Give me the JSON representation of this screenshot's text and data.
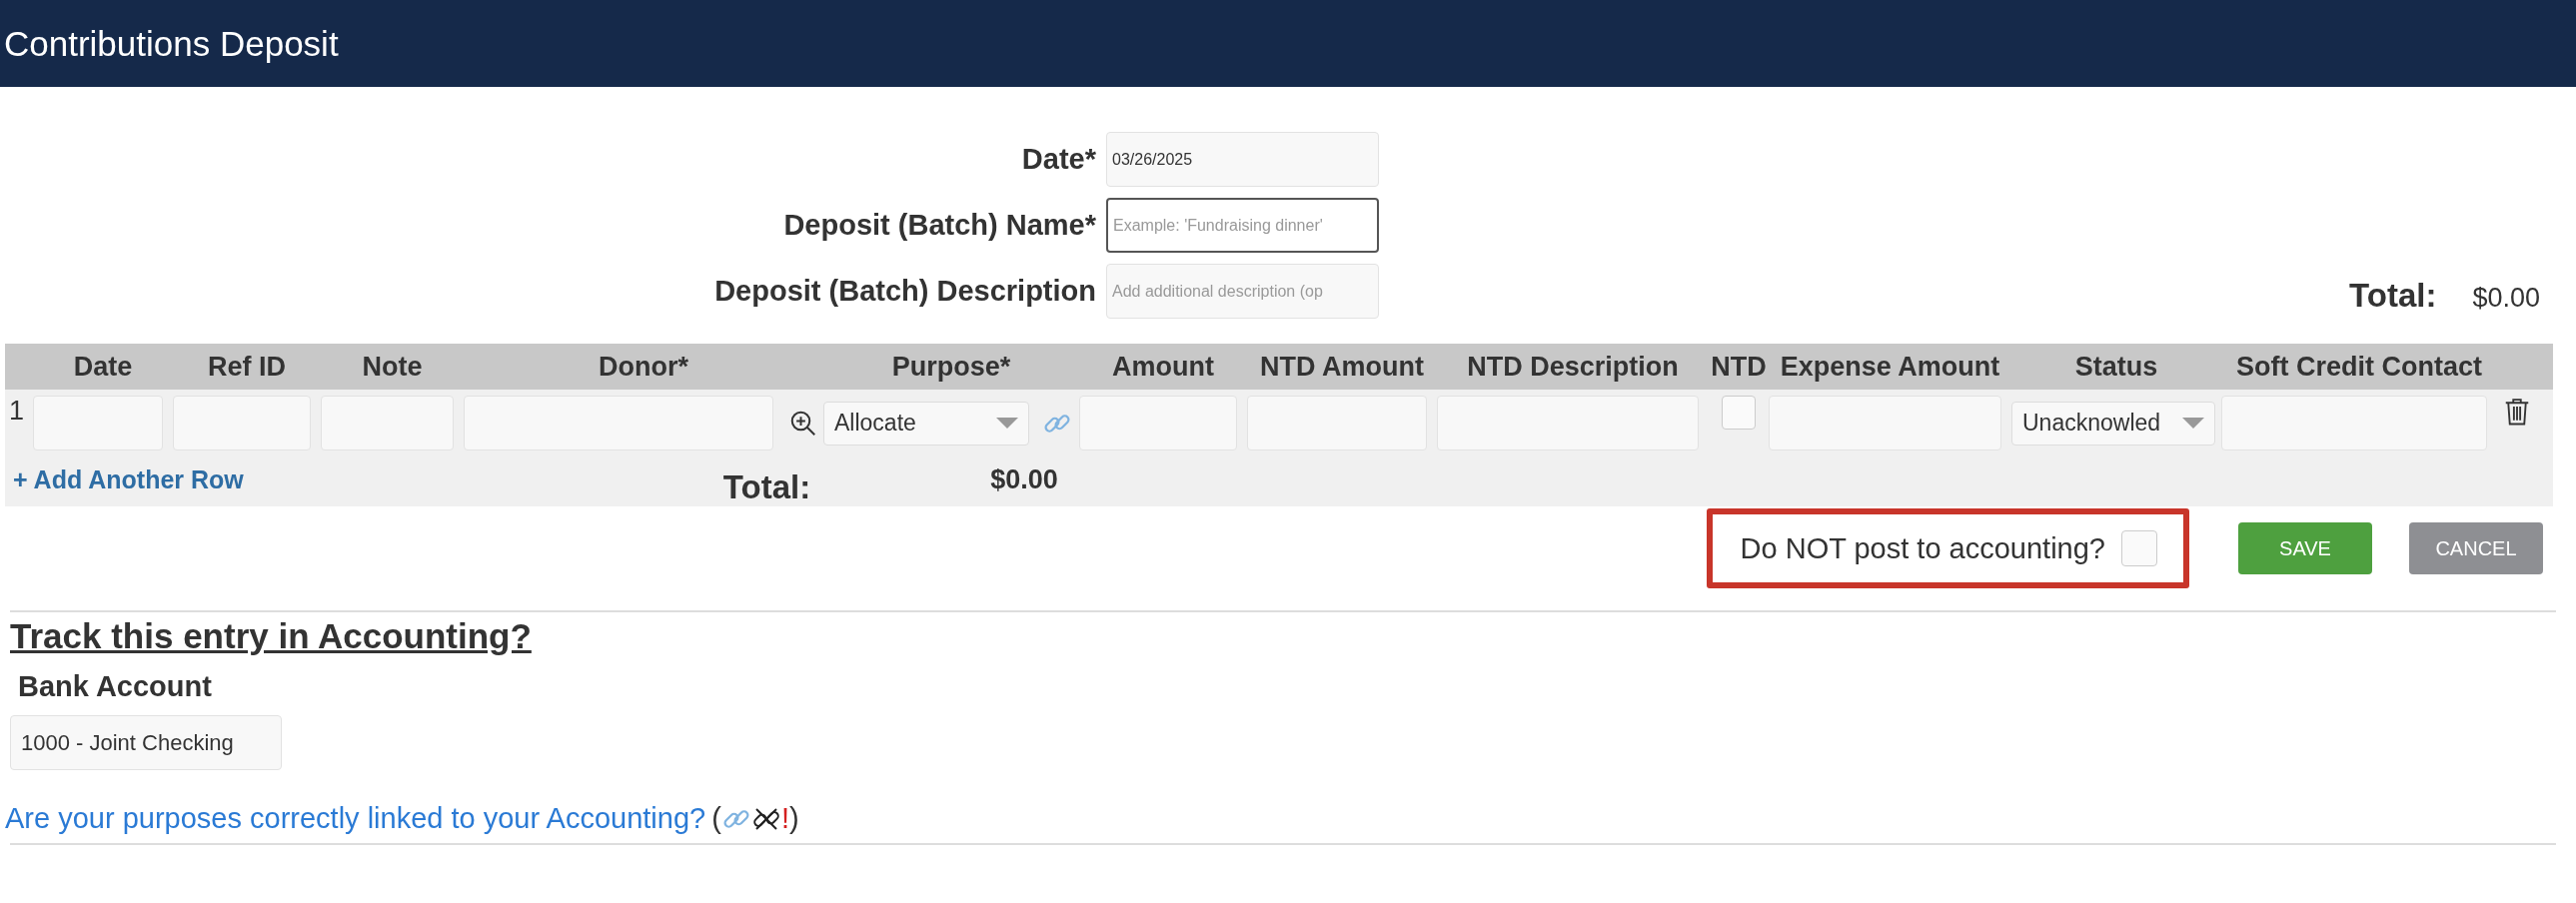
{
  "header": {
    "title": "Contributions Deposit"
  },
  "form": {
    "fields": [
      {
        "label": "Date*",
        "value": "03/26/2025",
        "focused": false
      },
      {
        "label": "Deposit (Batch) Name*",
        "placeholder": "Example: 'Fundraising dinner'",
        "focused": true
      },
      {
        "label": "Deposit (Batch) Description",
        "placeholder": "Add additional description (op",
        "focused": false
      }
    ],
    "total": {
      "label": "Total:",
      "value": "$0.00"
    }
  },
  "table": {
    "columns": [
      "Date",
      "Ref ID",
      "Note",
      "Donor*",
      "Purpose*",
      "Amount",
      "NTD Amount",
      "NTD Description",
      "NTD",
      "Expense Amount",
      "Status",
      "Soft Credit Contact"
    ],
    "rows": [
      {
        "number": "1",
        "purpose": "Allocate",
        "ntd_checked": false,
        "status": "Unacknowled"
      }
    ],
    "add_row": "+ Add Another Row",
    "total": {
      "label": "Total:",
      "value": "$0.00"
    }
  },
  "posting": {
    "label": "Do NOT post to accounting?",
    "checked": false
  },
  "buttons": [
    {
      "label": "SAVE",
      "kind": "primary"
    },
    {
      "label": "CANCEL",
      "kind": "secondary"
    }
  ],
  "accounting": {
    "heading": "Track this entry in Accounting?",
    "bank_label": "Bank Account",
    "bank_value": "1000 - Joint Checking",
    "link": "Are your purposes correctly linked to your Accounting?",
    "open_paren": "(",
    "warning_mark": "!",
    "close_paren": ")"
  }
}
